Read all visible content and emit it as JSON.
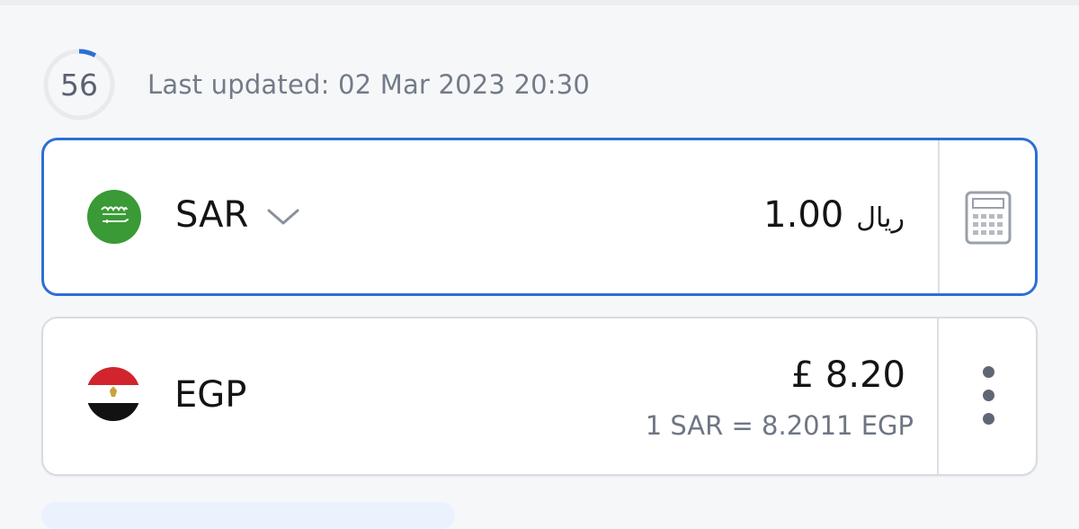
{
  "refresh": {
    "countdown": "56",
    "countdown_fraction": 0.08,
    "last_updated": "Last updated: 02 Mar 2023 20:30"
  },
  "base_currency": {
    "code": "SAR",
    "amount": "1.00",
    "symbol": "ريال",
    "flag_icon": "saudi-arabia-flag-icon",
    "selector_icon": "chevron-down-icon",
    "action_icon": "calculator-icon"
  },
  "target_currency": {
    "code": "EGP",
    "amount": "£ 8.20",
    "rate_text": "1 SAR = 8.2011 EGP",
    "flag_icon": "egypt-flag-icon",
    "action_icon": "more-vertical-icon"
  },
  "colors": {
    "accent": "#2c6fd6",
    "saudi_green": "#3a9a35",
    "egypt_red": "#d1242c",
    "egypt_black": "#121212"
  }
}
